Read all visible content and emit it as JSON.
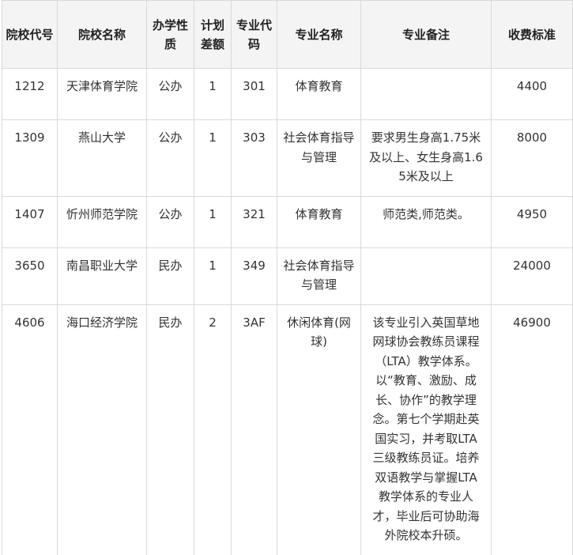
{
  "table": {
    "headers": [
      "院校代号",
      "院校名称",
      "办学性质",
      "计划差额",
      "专业代码",
      "专业名称",
      "专业备注",
      "收费标准"
    ],
    "rows": [
      [
        "1212",
        "天津体育学院",
        "公办",
        "1",
        "301",
        "体育教育",
        "",
        "4400"
      ],
      [
        "1309",
        "燕山大学",
        "公办",
        "1",
        "303",
        "社会体育指导与管理",
        "要求男生身高1.75米及以上、女生身高1.65米及以上",
        "8000"
      ],
      [
        "1407",
        "忻州师范学院",
        "公办",
        "1",
        "321",
        "体育教育",
        "师范类,师范类。",
        "4950"
      ],
      [
        "3650",
        "南昌职业大学",
        "民办",
        "1",
        "349",
        "社会体育指导与管理",
        "",
        "24000"
      ],
      [
        "4606",
        "海口经济学院",
        "民办",
        "2",
        "3AF",
        "休闲体育(网球)",
        "该专业引入英国草地网球协会教练员课程（LTA）教学体系。以“教育、激励、成长、协作”的教学理念。第七个学期赴英国实习，并考取LTA三级教练员证。培养双语教学与掌握LTA教学体系的专业人才，毕业后可协助海外院校本升硕。",
        "46900"
      ]
    ]
  }
}
